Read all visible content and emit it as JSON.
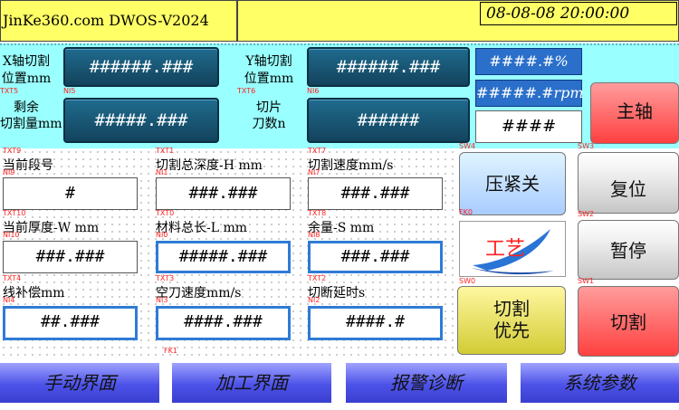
{
  "header": {
    "title": "JinKe360.com DWOS-V2024",
    "datetime": "08-08-08  20:00:00"
  },
  "upper": {
    "x_label_1": "X轴切割",
    "x_label_2": "位置mm",
    "x_value": "######.###",
    "y_label_1": "Y轴切割",
    "y_label_2": "位置mm",
    "y_value": "######.###",
    "remain_label_1": "剩余",
    "remain_label_2": "切割量mm",
    "remain_value": "#####.###",
    "blade_label_1": "切片",
    "blade_label_2": "刀数n",
    "blade_value": "######",
    "pct_value": "####.#%",
    "rpm_value": "#####.#rpm",
    "int_value": "####",
    "spindle_button": "主轴"
  },
  "fields": {
    "segment_label": "当前段号",
    "segment_value": "#",
    "total_depth_label": "切割总深度-H mm",
    "total_depth_value": "###.###",
    "speed_label": "切割速度mm/s",
    "speed_value": "###.###",
    "thickness_label": "当前厚度-W mm",
    "thickness_value": "###.###",
    "length_label": "材料总长-L mm",
    "length_value": "#####.###",
    "margin_label": "余量-S mm",
    "margin_value": "###.###",
    "comp_label": "线补偿mm",
    "comp_value": "##.###",
    "idle_label": "空刀速度mm/s",
    "idle_value": "####.###",
    "delay_label": "切断延时s",
    "delay_value": "####.#"
  },
  "buttons": {
    "clamp": "压紧关",
    "process": "工艺",
    "cut_first_1": "切割",
    "cut_first_2": "优先",
    "reset": "复位",
    "pause": "暂停",
    "cut": "切割"
  },
  "tags": {
    "txt5": "TXT5",
    "ni5": "NI5",
    "txt6": "TXT6",
    "ni6": "NI6",
    "txt9": "TXT9",
    "txt1": "TXT1",
    "txt7": "TXT7",
    "txt10": "TXT10",
    "txt0": "TXT0",
    "txt8": "TXT8",
    "txt4": "TXT4",
    "txt3": "TXT3",
    "txt2": "TXT2",
    "sw4": "SW4",
    "sw3": "SW3",
    "fk0": "FK0",
    "sw2": "SW2",
    "sw0": "SW0",
    "sw1": "SW1",
    "fk1": "FK1",
    "ni9": "NI9",
    "ni1": "NI1",
    "ni7": "NI7",
    "ni10": "NI10",
    "ni0": "NI0",
    "ni8": "NI8",
    "ni4": "NI4",
    "ni3": "NI3",
    "ni2": "NI2"
  },
  "nav": {
    "manual": "手动界面",
    "process": "加工界面",
    "alarm": "报警诊断",
    "params": "系统参数"
  },
  "colors": {
    "header_bg": "#ffff66",
    "panel_bg": "#99ffff",
    "display_button": "#1f6b8e",
    "spindle_red": "#ff5555",
    "nav_blue": "#4c52e8"
  }
}
